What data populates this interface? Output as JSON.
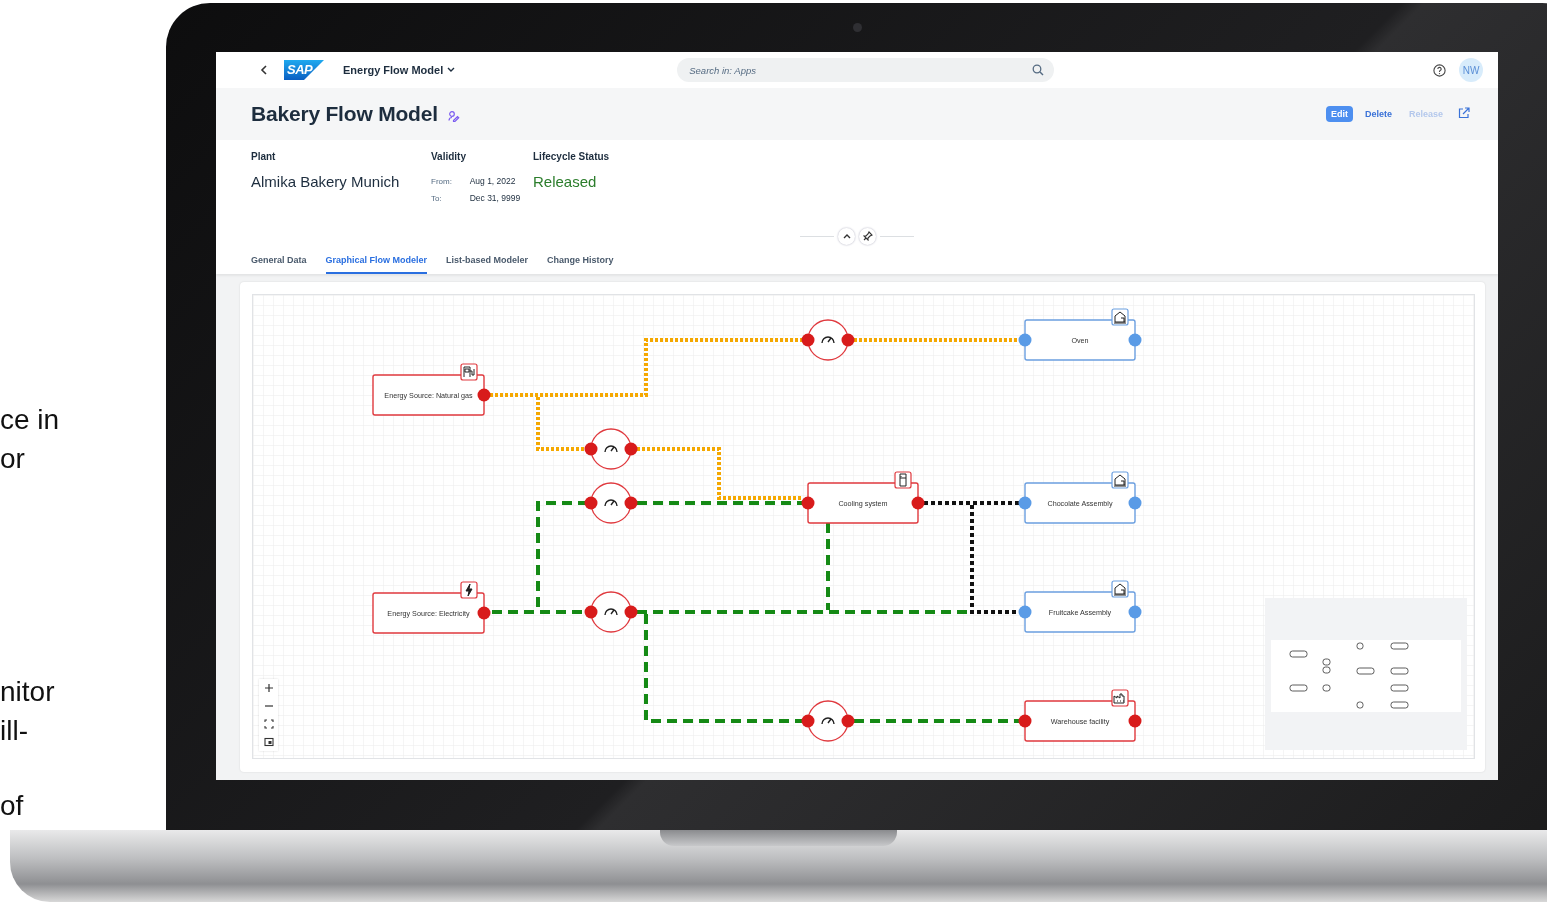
{
  "side_text": [
    "ce in",
    "or",
    "nitor",
    "ill-",
    "of"
  ],
  "shell": {
    "logo": "SAP",
    "app_title": "Energy Flow Model",
    "search": {
      "placeholder": "Search in: Apps"
    },
    "avatar": "NW"
  },
  "header": {
    "title": "Bakery Flow Model",
    "actions": [
      {
        "label": "Edit",
        "kind": "emphasized",
        "disabled": false
      },
      {
        "label": "Delete",
        "kind": "transparent",
        "disabled": false
      },
      {
        "label": "Release",
        "kind": "transparent",
        "disabled": true
      }
    ],
    "plant": {
      "label": "Plant",
      "value": "Almika Bakery Munich"
    },
    "validity": {
      "label": "Validity",
      "from_label": "From:",
      "from": "Aug 1, 2022",
      "to_label": "To:",
      "to": "Dec 31, 9999"
    },
    "lifecycle_status": {
      "label": "Lifecycle Status",
      "value": "Released"
    }
  },
  "tabs": [
    {
      "label": "General Data",
      "selected": false
    },
    {
      "label": "Graphical Flow Modeler",
      "selected": true
    },
    {
      "label": "List-based Modeler",
      "selected": false
    },
    {
      "label": "Change History",
      "selected": false
    }
  ],
  "diagram": {
    "nodes": [
      {
        "label": "Oven",
        "kind": "assembly",
        "color": "#6b9fe0"
      },
      {
        "label": "Energy Source: Natural gas",
        "kind": "gas_source",
        "color": "#e0393e"
      },
      {
        "label": "Cooling system",
        "kind": "cooling",
        "color": "#e0393e"
      },
      {
        "label": "Chocolate Assembly",
        "kind": "assembly",
        "color": "#6b9fe0"
      },
      {
        "label": "Energy Source: Electricity",
        "kind": "electric_source",
        "color": "#e0393e"
      },
      {
        "label": "Fruitcake Assembly",
        "kind": "assembly",
        "color": "#6b9fe0"
      },
      {
        "label": "Warehouse facility",
        "kind": "warehouse",
        "color": "#e0393e"
      }
    ],
    "connections": [
      {
        "kind": "gas"
      },
      {
        "kind": "gas"
      },
      {
        "kind": "gas"
      },
      {
        "kind": "gas"
      },
      {
        "kind": "electricity"
      },
      {
        "kind": "electricity"
      },
      {
        "kind": "electricity"
      },
      {
        "kind": "electricity"
      },
      {
        "kind": "electricity"
      },
      {
        "kind": "electricity"
      },
      {
        "kind": "electricity"
      },
      {
        "kind": "cooling"
      },
      {
        "kind": "cooling"
      }
    ]
  }
}
